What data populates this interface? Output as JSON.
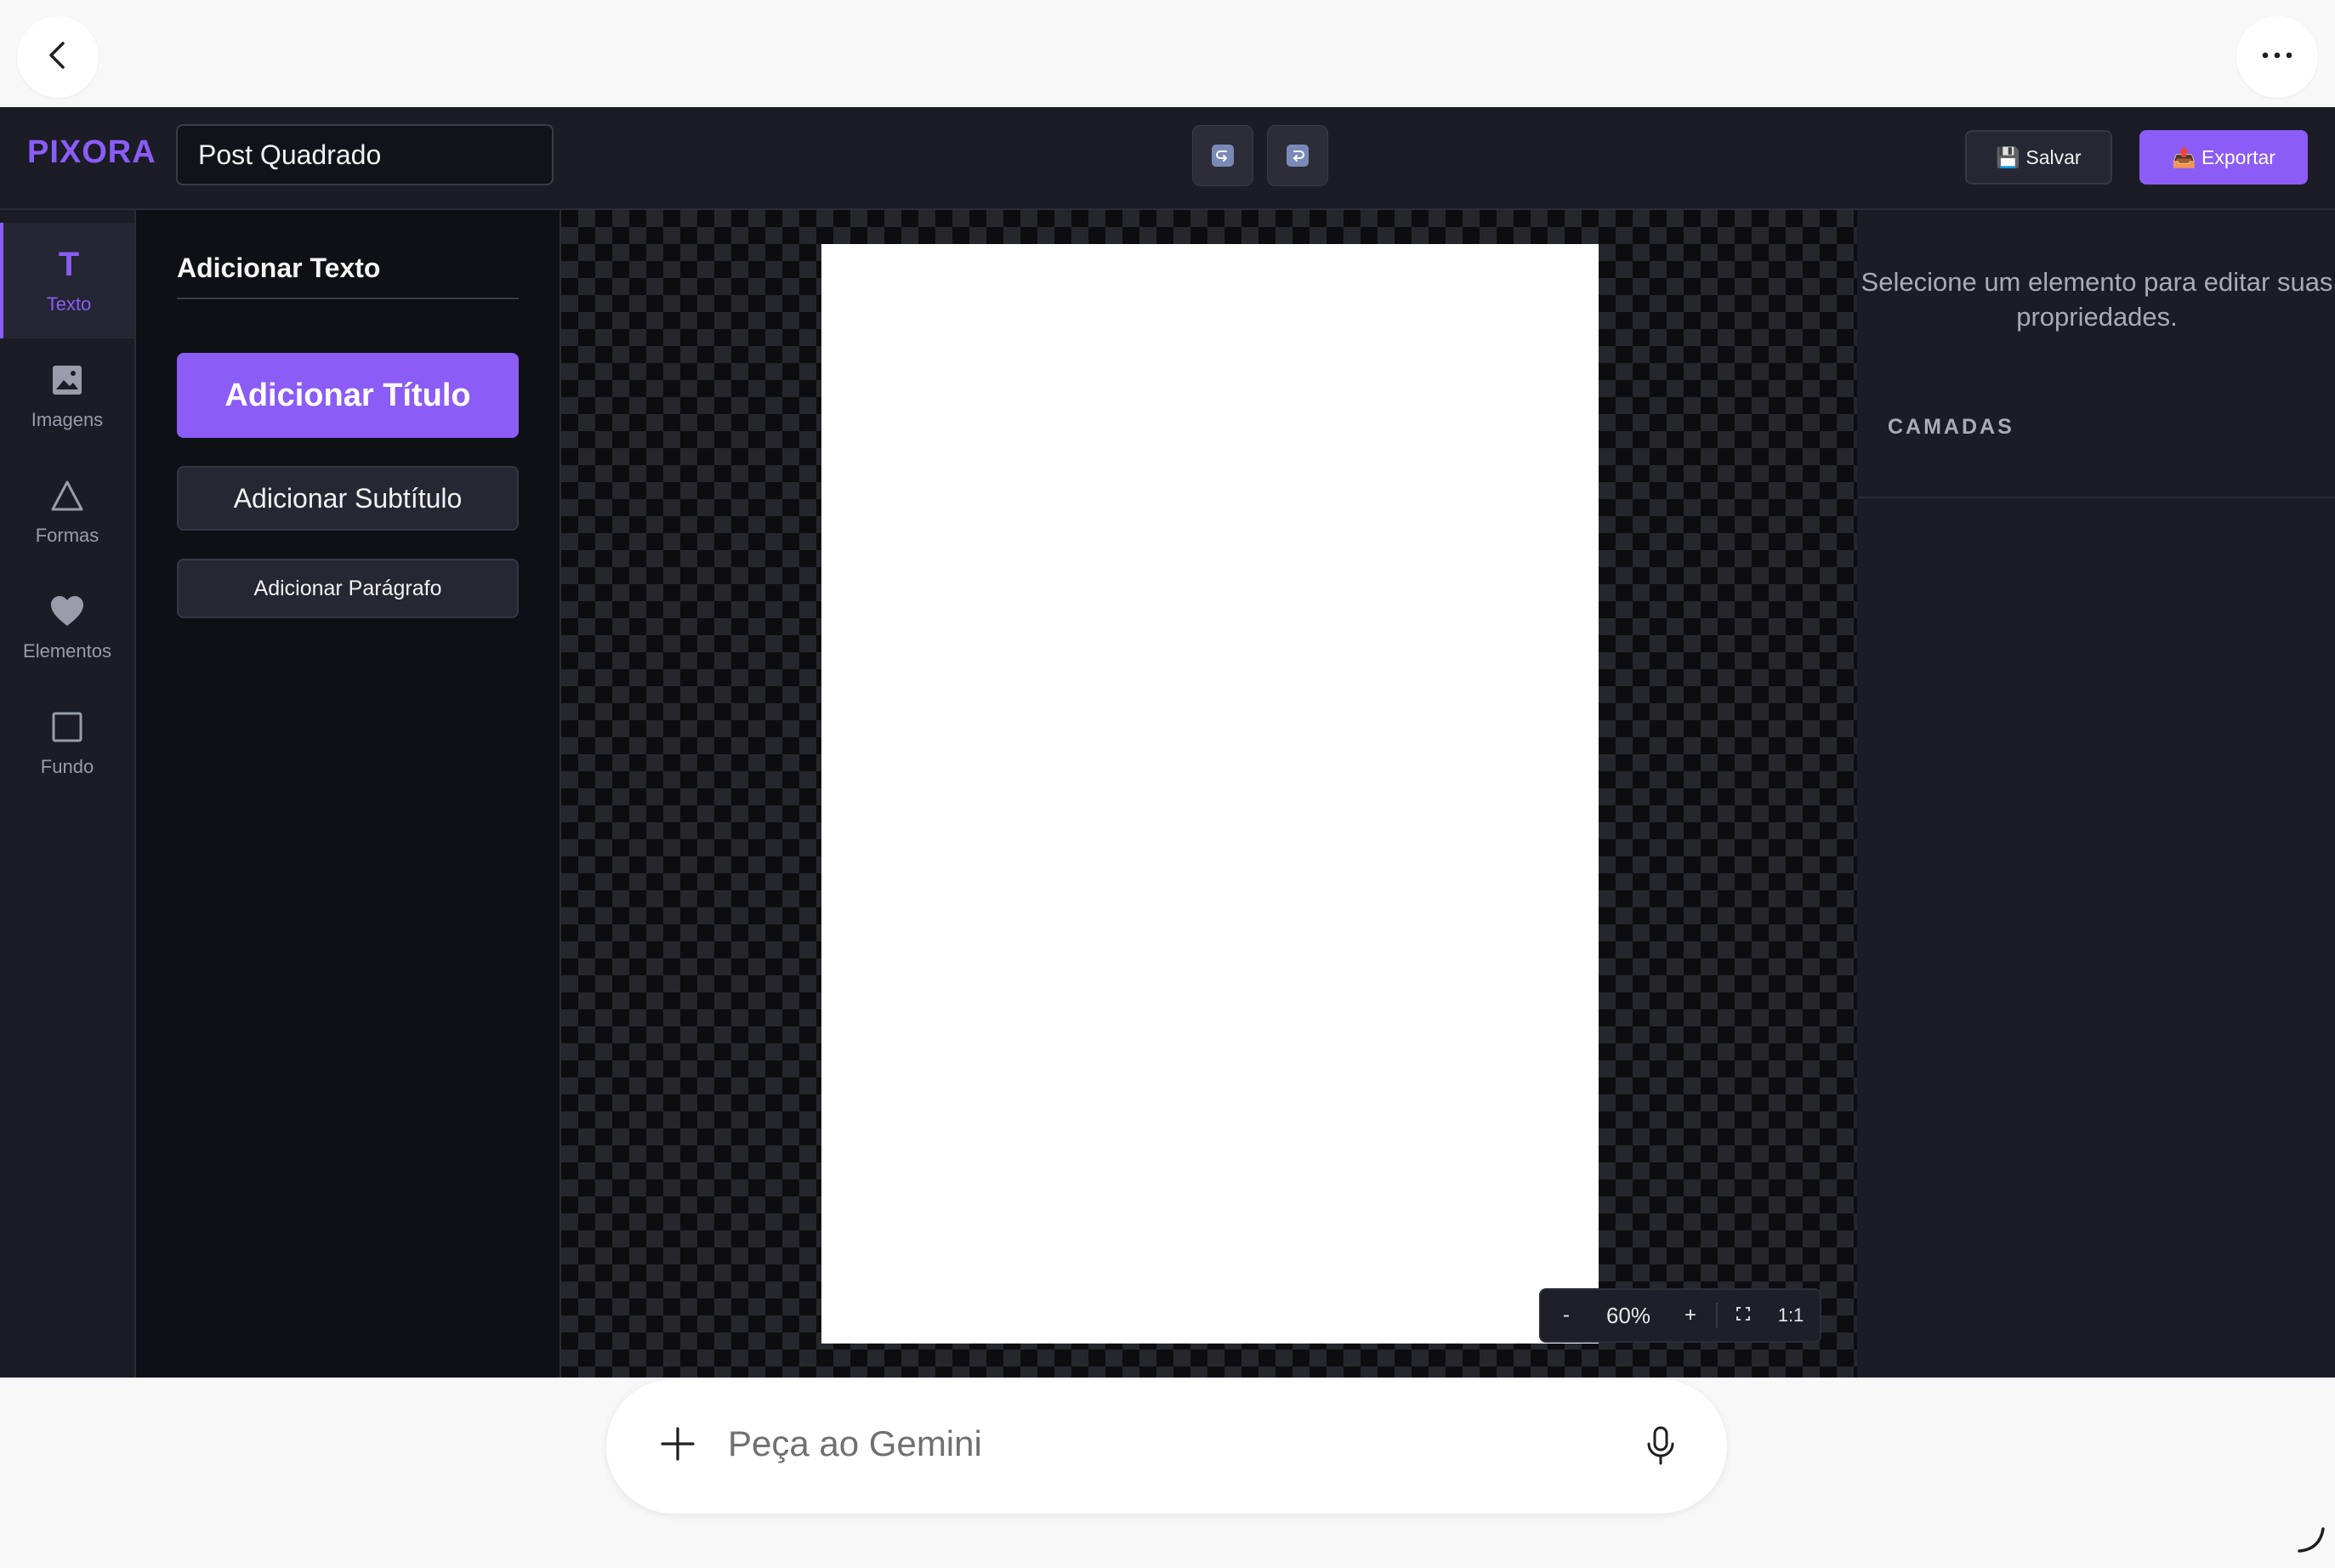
{
  "browser": {
    "back_icon": "chevron-left-icon",
    "more_icon": "more-horizontal-icon"
  },
  "header": {
    "logo": "PIXORA",
    "document_title": "Post Quadrado",
    "undo_icon": "undo-icon",
    "redo_icon": "redo-icon",
    "save_label": "💾 Salvar",
    "export_label": "📤 Exportar"
  },
  "sidebar": {
    "items": [
      {
        "label": "Texto",
        "icon": "text-icon",
        "active": true
      },
      {
        "label": "Imagens",
        "icon": "image-icon",
        "active": false
      },
      {
        "label": "Formas",
        "icon": "triangle-icon",
        "active": false
      },
      {
        "label": "Elementos",
        "icon": "heart-icon",
        "active": false
      },
      {
        "label": "Fundo",
        "icon": "square-icon",
        "active": false
      }
    ]
  },
  "panel": {
    "title": "Adicionar Texto",
    "add_title": "Adicionar Título",
    "add_subtitle": "Adicionar Subtítulo",
    "add_paragraph": "Adicionar Parágrafo"
  },
  "zoom": {
    "minus": "-",
    "level": "60%",
    "plus": "+",
    "fit_icon": "fit-screen-icon",
    "actual": "1:1"
  },
  "properties": {
    "hint": "Selecione um elemento para editar suas propriedades.",
    "layers_label": "CAMADAS"
  },
  "gemini": {
    "placeholder": "Peça ao Gemini",
    "plus_icon": "plus-icon",
    "mic_icon": "microphone-icon"
  },
  "colors": {
    "accent": "#8b5cf6",
    "app_bg": "#1b1c26",
    "panel_bg": "#0f1016"
  }
}
